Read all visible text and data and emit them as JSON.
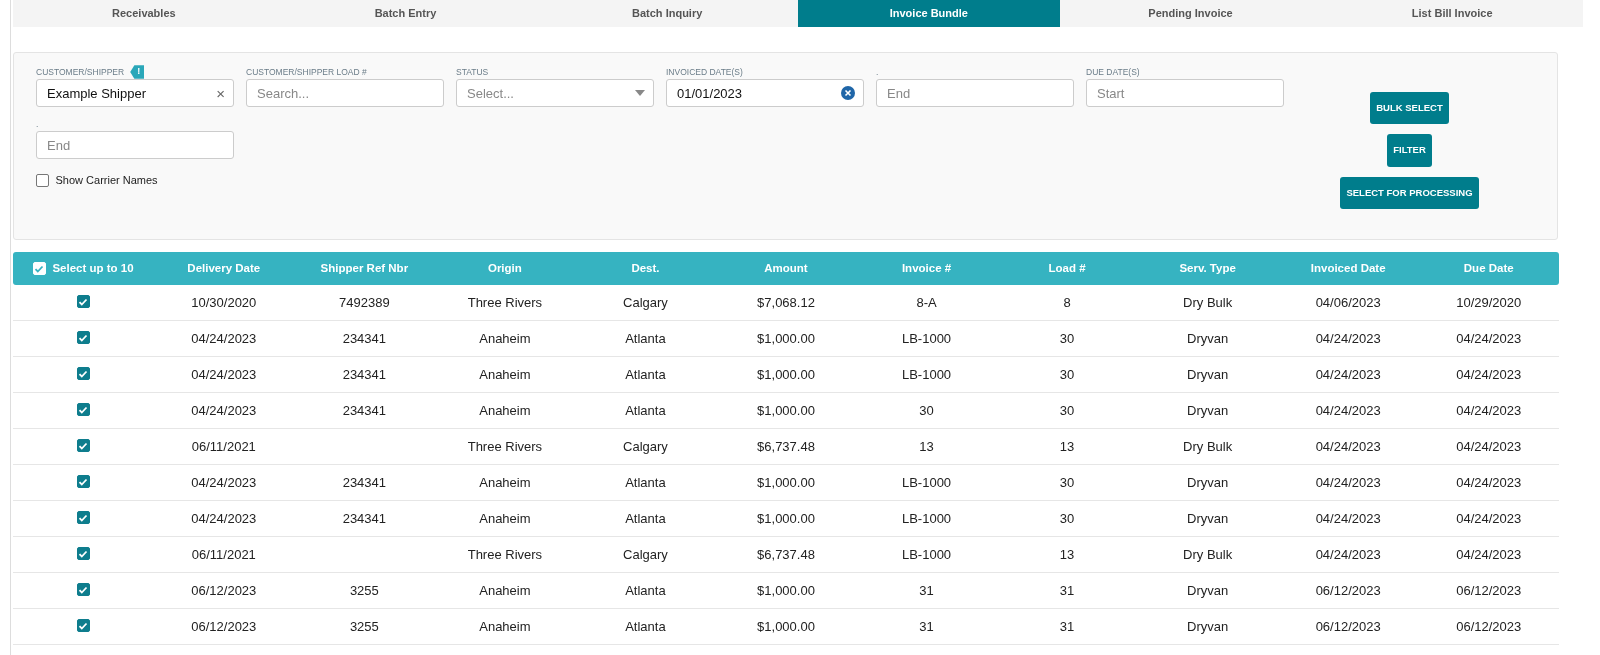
{
  "tabs": [
    {
      "label": "Receivables",
      "selected": false
    },
    {
      "label": "Batch Entry",
      "selected": false
    },
    {
      "label": "Batch Inquiry",
      "selected": false
    },
    {
      "label": "Invoice Bundle",
      "selected": true
    },
    {
      "label": "Pending Invoice",
      "selected": false
    },
    {
      "label": "List Bill Invoice",
      "selected": false
    }
  ],
  "filters": [
    {
      "label": "CUSTOMER/SHIPPER",
      "kind": "select",
      "value": "Example Shipper",
      "clear": "×",
      "warning": "!"
    },
    {
      "label": "CUSTOMER/SHIPPER LOAD #",
      "kind": "text",
      "placeholder": "Search..."
    },
    {
      "label": "STATUS",
      "kind": "dropdown",
      "placeholder": "Select..."
    },
    {
      "label": "INVOICED DATE(S)",
      "kind": "date",
      "value": "01/01/2023",
      "clearable": true
    },
    {
      "label": ".",
      "kind": "text",
      "placeholder": "End"
    },
    {
      "label": "DUE DATE(S)",
      "kind": "text",
      "placeholder": "Start"
    },
    {
      "label": ".",
      "kind": "text",
      "placeholder": "End"
    }
  ],
  "show_carrier_names": {
    "label": "Show Carrier Names",
    "checked": false
  },
  "buttons": [
    "BULK SELECT",
    "FILTER",
    "SELECT FOR PROCESSING"
  ],
  "table": {
    "select_all": {
      "label": "Select up to 10",
      "checked": true
    },
    "columns": [
      "Delivery Date",
      "Shipper Ref Nbr",
      "Origin",
      "Dest.",
      "Amount",
      "Invoice #",
      "Load #",
      "Serv. Type",
      "Invoiced Date",
      "Due Date"
    ],
    "rows": [
      {
        "checked": true,
        "cells": [
          "10/30/2020",
          "7492389",
          "Three Rivers",
          "Calgary",
          "$7,068.12",
          "8-A",
          "8",
          "Dry Bulk",
          "04/06/2023",
          "10/29/2020"
        ]
      },
      {
        "checked": true,
        "cells": [
          "04/24/2023",
          "234341",
          "Anaheim",
          "Atlanta",
          "$1,000.00",
          "LB-1000",
          "30",
          "Dryvan",
          "04/24/2023",
          "04/24/2023"
        ]
      },
      {
        "checked": true,
        "cells": [
          "04/24/2023",
          "234341",
          "Anaheim",
          "Atlanta",
          "$1,000.00",
          "LB-1000",
          "30",
          "Dryvan",
          "04/24/2023",
          "04/24/2023"
        ]
      },
      {
        "checked": true,
        "cells": [
          "04/24/2023",
          "234341",
          "Anaheim",
          "Atlanta",
          "$1,000.00",
          "30",
          "30",
          "Dryvan",
          "04/24/2023",
          "04/24/2023"
        ]
      },
      {
        "checked": true,
        "cells": [
          "06/11/2021",
          "",
          "Three Rivers",
          "Calgary",
          "$6,737.48",
          "13",
          "13",
          "Dry Bulk",
          "04/24/2023",
          "04/24/2023"
        ]
      },
      {
        "checked": true,
        "cells": [
          "04/24/2023",
          "234341",
          "Anaheim",
          "Atlanta",
          "$1,000.00",
          "LB-1000",
          "30",
          "Dryvan",
          "04/24/2023",
          "04/24/2023"
        ]
      },
      {
        "checked": true,
        "cells": [
          "04/24/2023",
          "234341",
          "Anaheim",
          "Atlanta",
          "$1,000.00",
          "LB-1000",
          "30",
          "Dryvan",
          "04/24/2023",
          "04/24/2023"
        ]
      },
      {
        "checked": true,
        "cells": [
          "06/11/2021",
          "",
          "Three Rivers",
          "Calgary",
          "$6,737.48",
          "LB-1000",
          "13",
          "Dry Bulk",
          "04/24/2023",
          "04/24/2023"
        ]
      },
      {
        "checked": true,
        "cells": [
          "06/12/2023",
          "3255",
          "Anaheim",
          "Atlanta",
          "$1,000.00",
          "31",
          "31",
          "Dryvan",
          "06/12/2023",
          "06/12/2023"
        ]
      },
      {
        "checked": true,
        "cells": [
          "06/12/2023",
          "3255",
          "Anaheim",
          "Atlanta",
          "$1,000.00",
          "31",
          "31",
          "Dryvan",
          "06/12/2023",
          "06/12/2023"
        ]
      }
    ]
  }
}
